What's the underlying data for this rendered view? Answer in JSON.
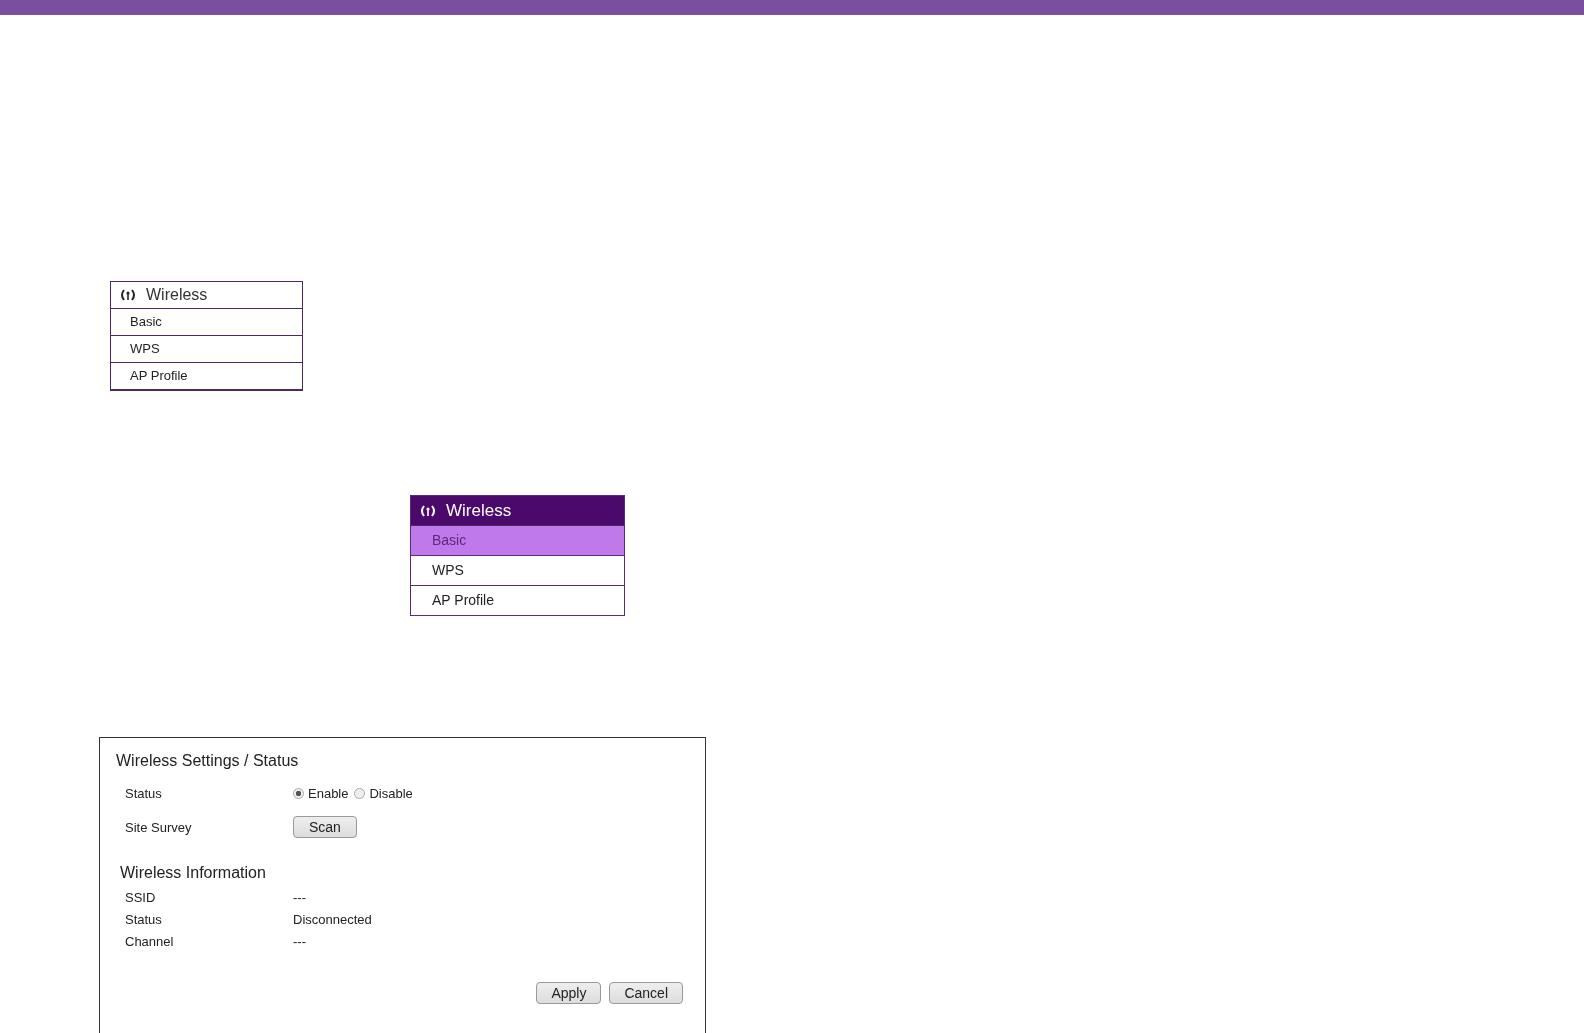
{
  "menus": [
    {
      "kind": "plain",
      "title": "Wireless",
      "items": [
        {
          "label": "Basic",
          "selected": false
        },
        {
          "label": "WPS",
          "selected": false
        },
        {
          "label": "AP Profile",
          "selected": false
        }
      ]
    },
    {
      "kind": "themed",
      "title": "Wireless",
      "items": [
        {
          "label": "Basic",
          "selected": true
        },
        {
          "label": "WPS",
          "selected": false
        },
        {
          "label": "AP Profile",
          "selected": false
        }
      ]
    }
  ],
  "panel": {
    "title": "Wireless Settings / Status",
    "settings": [
      {
        "kind": "radio",
        "label": "Status",
        "options": [
          {
            "label": "Enable",
            "selected": true
          },
          {
            "label": "Disable",
            "selected": false
          }
        ]
      },
      {
        "kind": "button",
        "label": "Site Survey",
        "button": "Scan"
      }
    ],
    "info_title": "Wireless Information",
    "info": [
      {
        "label": "SSID",
        "value": "---"
      },
      {
        "label": "Status",
        "value": "Disconnected"
      },
      {
        "label": "Channel",
        "value": "---"
      }
    ],
    "buttons": [
      "Apply",
      "Cancel"
    ]
  }
}
